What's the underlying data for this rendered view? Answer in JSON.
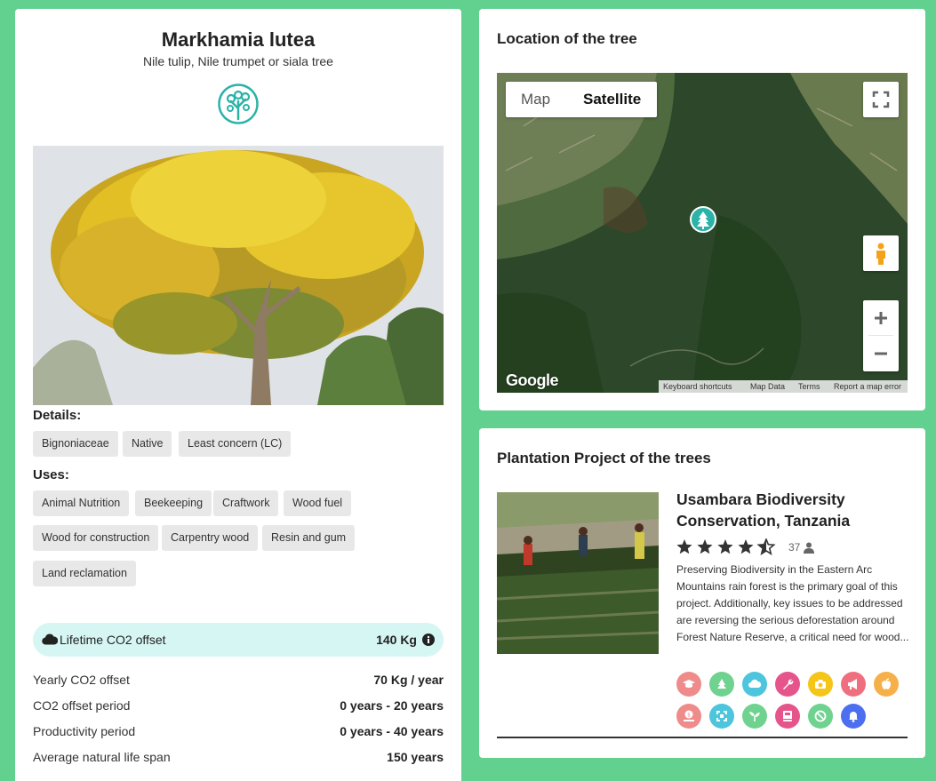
{
  "tree": {
    "scientific_name": "Markhamia lutea",
    "common_names": "Nile tulip, Nile trumpet or siala tree",
    "details_label": "Details:",
    "details": [
      "Bignoniaceae",
      "Native",
      "Least concern (LC)"
    ],
    "uses_label": "Uses:",
    "uses": [
      "Animal Nutrition",
      "Beekeeping",
      "Craftwork",
      "Wood fuel",
      "Wood for construction",
      "Carpentry wood",
      "Resin and gum",
      "Land reclamation"
    ],
    "co2": {
      "lifetime_label": "Lifetime CO2 offset",
      "lifetime_value": "140 Kg",
      "stats": [
        {
          "label": "Yearly CO2 offset",
          "value": "70 Kg / year"
        },
        {
          "label": "CO2 offset period",
          "value": "0 years - 20 years"
        },
        {
          "label": "Productivity period",
          "value": "0 years - 40 years"
        },
        {
          "label": "Average natural life span",
          "value": "150 years"
        }
      ]
    }
  },
  "location": {
    "heading": "Location of the tree",
    "map_tab": "Map",
    "satellite_tab": "Satellite",
    "active_tab": "Satellite",
    "google_logo": "Google",
    "footer": [
      "Keyboard shortcuts",
      "Map Data",
      "Terms",
      "Report a map error"
    ]
  },
  "project": {
    "heading": "Plantation Project of the trees",
    "title": "Usambara Biodiversity Conservation, Tanzania",
    "rating": 4.5,
    "reviews": "37",
    "description": "Preserving Biodiversity in the Eastern Arc Mountains rain forest is the primary goal of this project. Additionally, key issues to be addressed are reversing the serious deforestation around Forest Nature Reserve, a critical need for wood...",
    "icons": [
      {
        "name": "education-icon",
        "color": "#ef8b8b"
      },
      {
        "name": "tree-icon",
        "color": "#6fd28f"
      },
      {
        "name": "cloud-icon",
        "color": "#4cc5dd"
      },
      {
        "name": "wrench-icon",
        "color": "#e5558b"
      },
      {
        "name": "camera-icon",
        "color": "#f5c518"
      },
      {
        "name": "megaphone-icon",
        "color": "#ef6f7f"
      },
      {
        "name": "apple-icon",
        "color": "#f6b04a"
      },
      {
        "name": "money-icon",
        "color": "#ef8b8b"
      },
      {
        "name": "expand-icon",
        "color": "#4cc5dd"
      },
      {
        "name": "sprout-icon",
        "color": "#6fd28f"
      },
      {
        "name": "book-icon",
        "color": "#e5558b"
      },
      {
        "name": "ban-icon",
        "color": "#6fd28f"
      },
      {
        "name": "bell-icon",
        "color": "#4c6ff0"
      }
    ]
  },
  "colors": {
    "page_background": "#62d08e",
    "brand_teal": "#2bb3a8",
    "co2_bar": "#d6f6f4"
  }
}
